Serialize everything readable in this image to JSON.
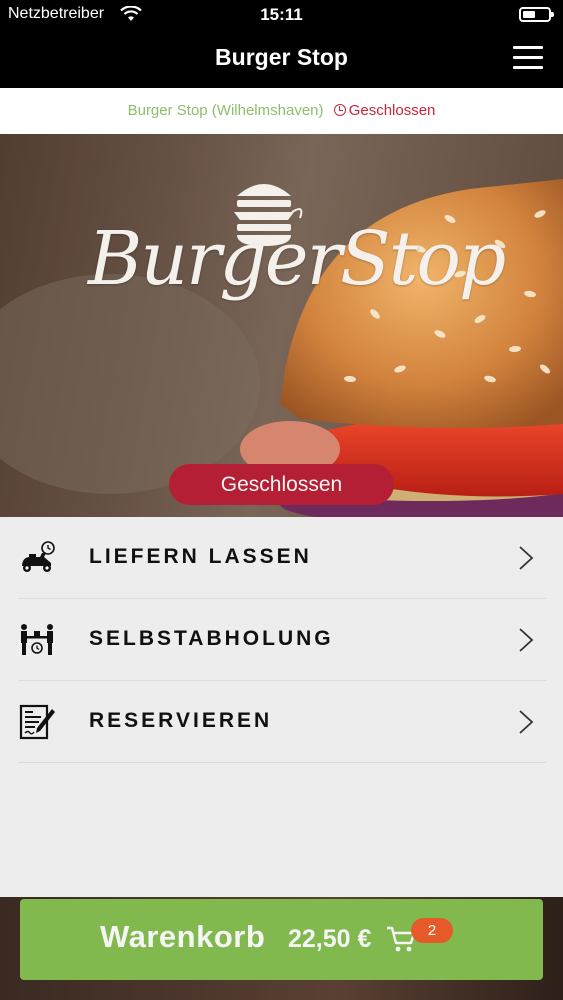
{
  "status_bar": {
    "carrier": "Netzbetreiber",
    "time": "15:11",
    "battery_level": 0.5
  },
  "nav": {
    "title": "Burger Stop"
  },
  "info_bar": {
    "location": "Burger Stop (Wilhelmshaven)",
    "status": "Geschlossen"
  },
  "hero": {
    "logo_text": "BurgerStop",
    "status_pill": "Geschlossen"
  },
  "menu": {
    "items": [
      {
        "label": "LIEFERN LASSEN",
        "icon": "delivery-scooter-icon"
      },
      {
        "label": "SELBSTABHOLUNG",
        "icon": "pickup-icon"
      },
      {
        "label": "RESERVIEREN",
        "icon": "reservation-icon"
      }
    ]
  },
  "cart": {
    "label": "Warenkorb",
    "total": "22,50 €",
    "count": "2"
  },
  "colors": {
    "accent_green": "#82b94f",
    "closed_red": "#b51f35",
    "location_green": "#8cc06b",
    "badge_orange": "#e65a2a"
  }
}
